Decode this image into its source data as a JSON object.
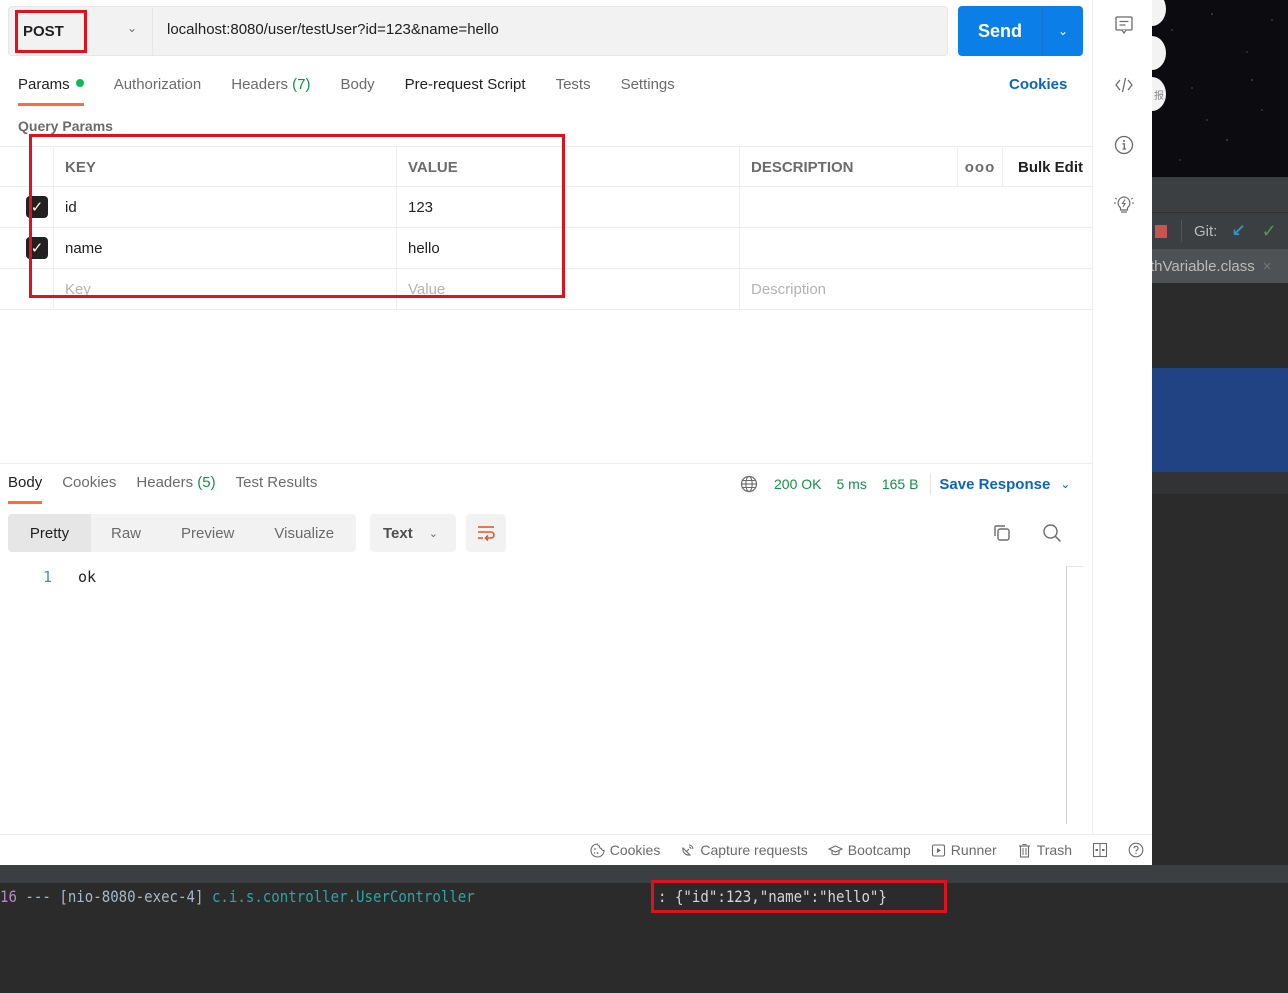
{
  "request": {
    "method": "POST",
    "url": "localhost:8080/user/testUser?id=123&name=hello",
    "send_label": "Send"
  },
  "request_tabs": [
    {
      "label": "Params",
      "active": true,
      "has_dot": true
    },
    {
      "label": "Authorization"
    },
    {
      "label": "Headers",
      "count": "(7)"
    },
    {
      "label": "Body"
    },
    {
      "label": "Pre-request Script"
    },
    {
      "label": "Tests"
    },
    {
      "label": "Settings"
    }
  ],
  "cookies_link": "Cookies",
  "query_params": {
    "title": "Query Params",
    "headers": {
      "key": "KEY",
      "value": "VALUE",
      "description": "DESCRIPTION",
      "more": "ooo",
      "bulk_edit": "Bulk Edit"
    },
    "rows": [
      {
        "checked": true,
        "key": "id",
        "value": "123",
        "description": ""
      },
      {
        "checked": true,
        "key": "name",
        "value": "hello",
        "description": ""
      }
    ],
    "placeholders": {
      "key": "Key",
      "value": "Value",
      "description": "Description"
    }
  },
  "response": {
    "tabs": [
      {
        "label": "Body",
        "active": true
      },
      {
        "label": "Cookies"
      },
      {
        "label": "Headers",
        "count": "(5)"
      },
      {
        "label": "Test Results"
      }
    ],
    "status": "200 OK",
    "time": "5 ms",
    "size": "165 B",
    "save_label": "Save Response",
    "formats": [
      "Pretty",
      "Raw",
      "Preview",
      "Visualize"
    ],
    "active_format": "Pretty",
    "type": "Text",
    "lines": [
      {
        "number": "1",
        "text": "ok"
      }
    ]
  },
  "status_bar": {
    "items": [
      {
        "icon": "cookie-icon",
        "label": "Cookies"
      },
      {
        "icon": "satellite-icon",
        "label": "Capture requests"
      },
      {
        "icon": "graduation-cap-icon",
        "label": "Bootcamp"
      },
      {
        "icon": "play-icon",
        "label": "Runner"
      },
      {
        "icon": "trash-icon",
        "label": "Trash"
      }
    ]
  },
  "ide": {
    "git_label": "Git:",
    "tab_label": "thVariable.class",
    "tab_close": "×",
    "bg_circle_text": "报"
  },
  "console": {
    "pid_fragment": "16",
    "separator": " --- ",
    "thread": "[nio-8080-exec-4]",
    "logger": "c.i.s.controller.UserController",
    "message": ": {\"id\":123,\"name\":\"hello\"}"
  },
  "colors": {
    "accent_orange": "#ff6c37",
    "send_blue": "#0c7ee7",
    "link_blue": "#0c63c7",
    "success_green": "#168f48",
    "annotation_red": "#e0111c"
  }
}
